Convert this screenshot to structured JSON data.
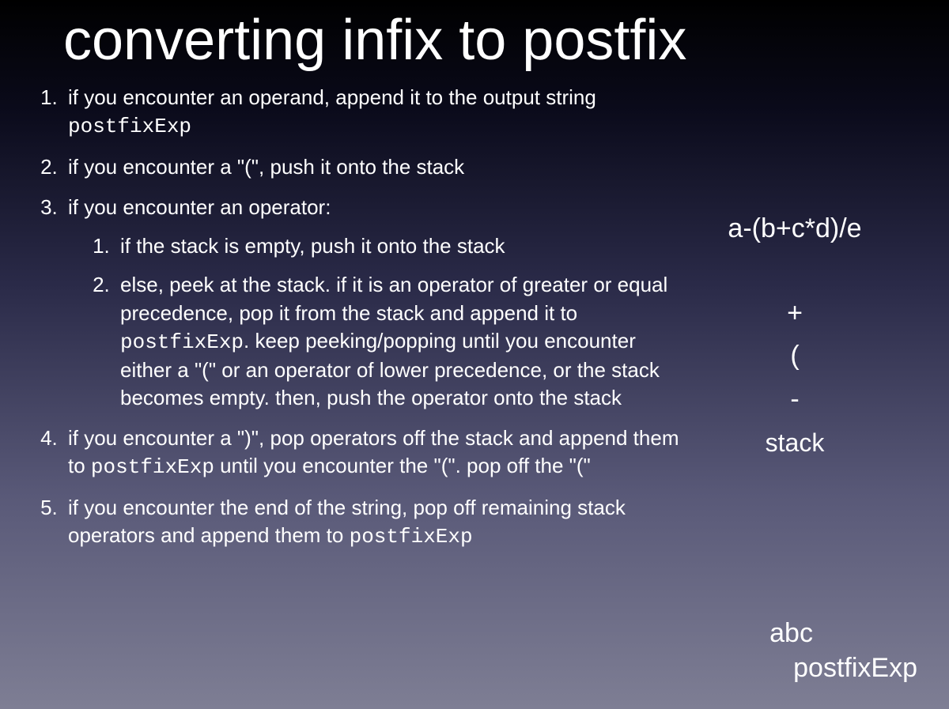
{
  "title": "converting infix to postfix",
  "steps": {
    "s1a": "if you encounter an operand, append it to the output string ",
    "s1b": "postfixExp",
    "s2": "if you encounter a \"(\", push it onto the stack",
    "s3": "if you encounter an operator:",
    "s3_1": "if the stack is empty, push it onto the stack",
    "s3_2a": "else, peek at the stack.  if it is an operator of greater or equal precedence, pop it from the stack and append it to ",
    "s3_2b": "postfixExp",
    "s3_2c": ".  keep peeking/popping until you encounter either a \"(\" or an operator of lower precedence, or the stack becomes empty.  then, push the operator onto the stack",
    "s4a": "if you encounter a \")\", pop operators off the stack and append them to ",
    "s4b": "postfixExp",
    "s4c": " until you encounter the \"(\".  pop off the \"(\"",
    "s5a": "if you encounter the end of the string, pop off remaining stack operators and append them to ",
    "s5b": "postfixExp"
  },
  "example": {
    "infix": "a-(b+c*d)/e",
    "stack_top": "+",
    "stack_mid": "(",
    "stack_bot": "-",
    "stack_label": "stack",
    "postfix_value": "abc",
    "postfix_label": "postfixExp"
  }
}
